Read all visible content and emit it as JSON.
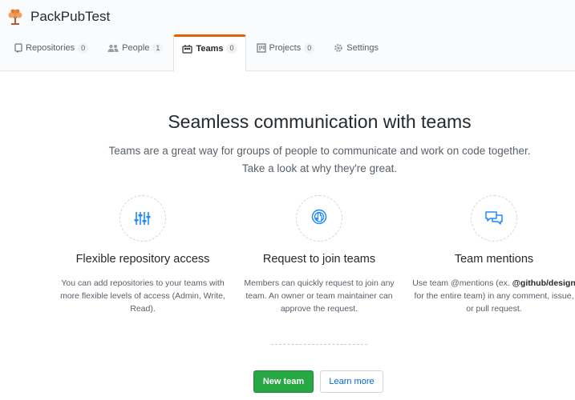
{
  "org": {
    "name": "PackPubTest"
  },
  "tabs": [
    {
      "label": "Repositories",
      "count": "0",
      "icon": "repo-icon"
    },
    {
      "label": "People",
      "count": "1",
      "icon": "people-icon"
    },
    {
      "label": "Teams",
      "count": "0",
      "icon": "team-icon",
      "selected": true
    },
    {
      "label": "Projects",
      "count": "0",
      "icon": "project-icon"
    },
    {
      "label": "Settings",
      "icon": "gear-icon"
    }
  ],
  "blankslate": {
    "title": "Seamless communication with teams",
    "desc_line1": "Teams are a great way for groups of people to communicate and work on code together.",
    "desc_line2": "Take a look at why they're great."
  },
  "features": [
    {
      "icon": "sliders-icon",
      "title": "Flexible repository access",
      "text": "You can add repositories to your teams with more flexible levels of access (Admin, Write, Read)."
    },
    {
      "icon": "hand-raise-icon",
      "title": "Request to join teams",
      "text": "Members can quickly request to join any team. An owner or team maintainer can approve the request."
    },
    {
      "icon": "comment-discussion-icon",
      "title": "Team mentions",
      "text_before": "Use team @mentions (ex.",
      "text_strong": "@github/design",
      "text_after": "for the entire team) in any comment, issue, or pull request."
    }
  ],
  "actions": {
    "primary": "New team",
    "secondary": "Learn more"
  },
  "colors": {
    "accent_orange": "#e36209",
    "primary_green": "#28a745",
    "link_blue": "#0366d6",
    "icon_blue": "#2188ff"
  }
}
